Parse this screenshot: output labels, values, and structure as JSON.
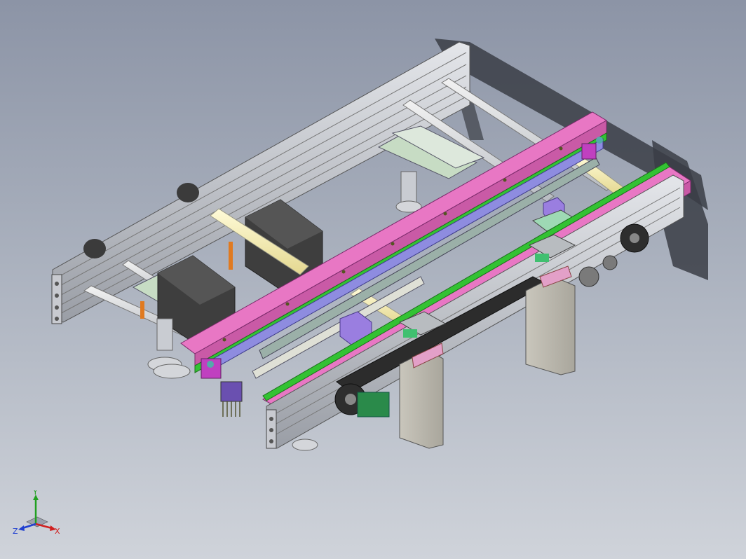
{
  "view": {
    "background_top": "#8c94a6",
    "background_bottom": "#cfd3da"
  },
  "triad": {
    "x_label": "X",
    "y_label": "Y",
    "z_label": "Z",
    "x_color": "#d02020",
    "y_color": "#20a020",
    "z_color": "#2040d0"
  }
}
